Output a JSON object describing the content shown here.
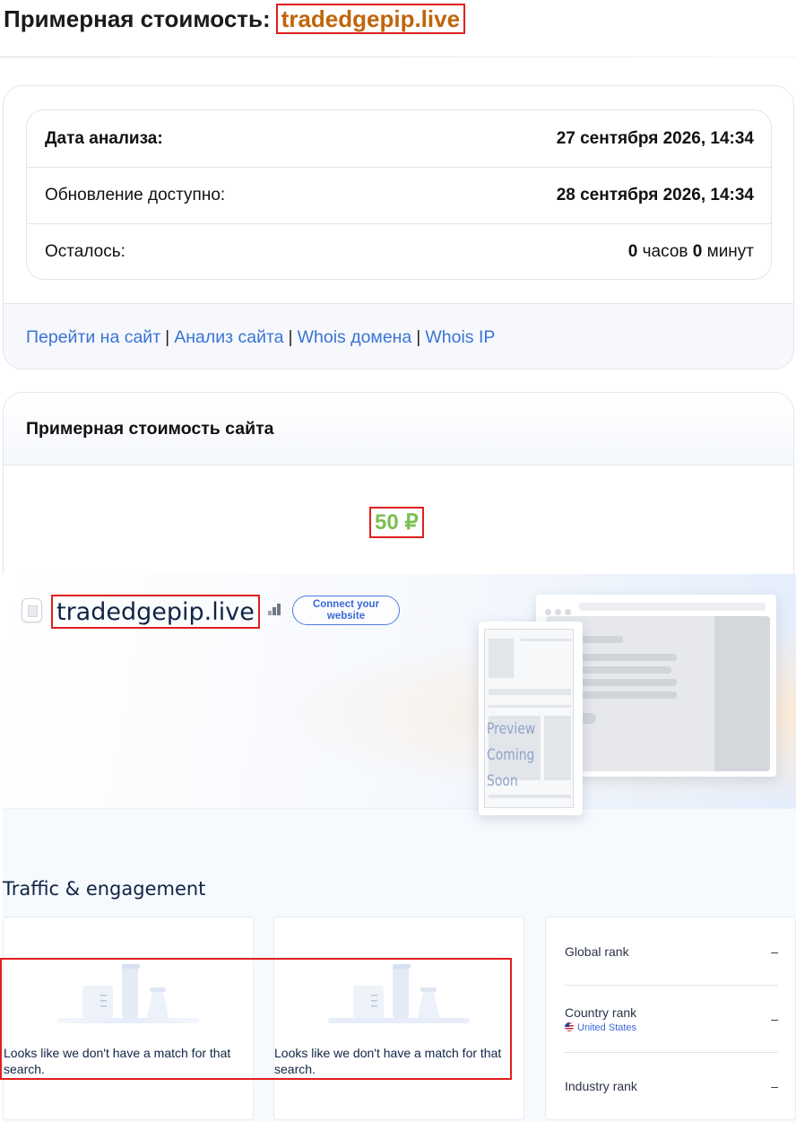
{
  "header": {
    "label": "Примерная стоимость:",
    "domain": "tradedgepip.live"
  },
  "analysis": {
    "rows": [
      {
        "label": "Дата анализа:",
        "value": "27 сентября 2026, 14:34"
      },
      {
        "label": "Обновление доступно:",
        "value": "28 сентября 2026, 14:34"
      }
    ],
    "remaining": {
      "label": "Осталось:",
      "hours": "0",
      "hours_unit": "часов",
      "minutes": "0",
      "minutes_unit": "минут"
    },
    "links": [
      "Перейти на сайт",
      "Анализ сайта",
      "Whois домена",
      "Whois IP"
    ],
    "link_separator": "|"
  },
  "valuation": {
    "title": "Примерная стоимость сайта",
    "price": "50 ₽",
    "price_color": "#7cbf52"
  },
  "similarweb": {
    "domain": "tradedgepip.live",
    "connect_button": "Connect your website",
    "preview_text": [
      "Preview",
      "Coming Soon"
    ],
    "traffic_title": "Traffic & engagement",
    "no_match": "Looks like we don't have a match for that search.",
    "ranks": [
      {
        "label": "Global rank",
        "value": "–"
      },
      {
        "label": "Country rank",
        "sub": "United States",
        "value": "–"
      },
      {
        "label": "Industry rank",
        "value": "–"
      }
    ]
  },
  "icons": [
    "favicon-icon",
    "signal-bars-icon",
    "us-flag-icon",
    "empty-state-illustration"
  ],
  "colors": {
    "domain_accent": "#c0650a",
    "link": "#3a73d6",
    "highlight": "#e01f1f",
    "brand_blue": "#3a68d6"
  }
}
